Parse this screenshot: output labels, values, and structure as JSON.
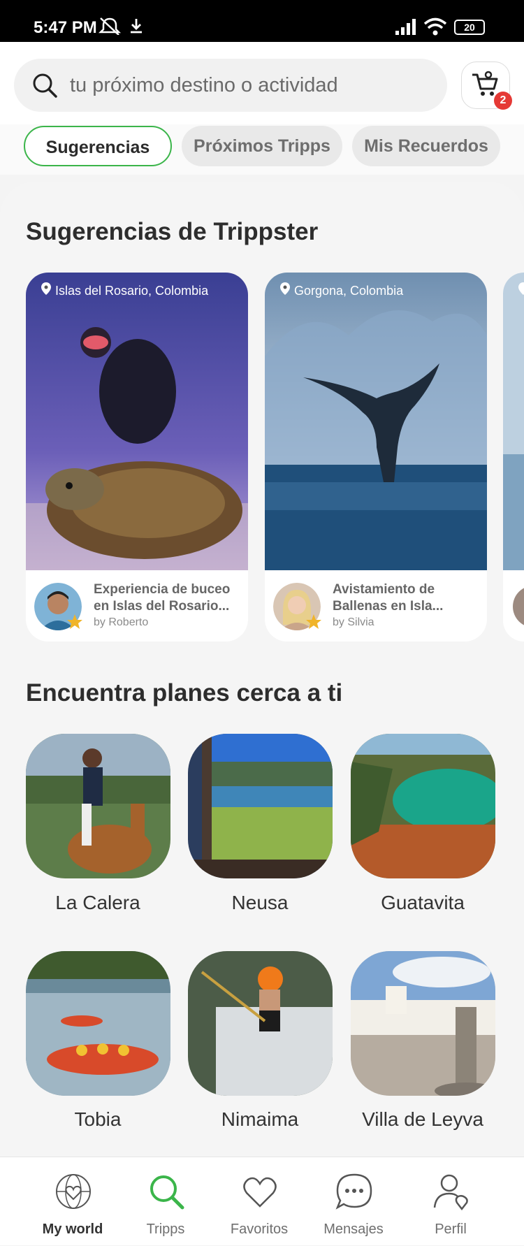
{
  "status_bar": {
    "time": "5:47 PM",
    "battery": "20"
  },
  "search": {
    "placeholder": "tu próximo destino o actividad"
  },
  "cart": {
    "count": "2"
  },
  "tabs": [
    {
      "label": "Sugerencias",
      "active": true
    },
    {
      "label": "Próximos Tripps",
      "active": false
    },
    {
      "label": "Mis Recuerdos",
      "active": false
    }
  ],
  "suggestions": {
    "title": "Sugerencias de Trippster",
    "cards": [
      {
        "location": "Islas del Rosario, Colombia",
        "title": "Experiencia de buceo en Islas del Rosario...",
        "by": "by Roberto"
      },
      {
        "location": "Gorgona, Colombia",
        "title": "Avistamiento de Ballenas en Isla...",
        "by": "by Silvia"
      }
    ]
  },
  "nearby": {
    "title": "Encuentra planes cerca a ti",
    "places": [
      "La Calera",
      "Neusa",
      "Guatavita",
      "Tobia",
      "Nimaima",
      "Villa de Leyva"
    ]
  },
  "bottom_nav": [
    {
      "label": "My world",
      "active": true
    },
    {
      "label": "Tripps",
      "active": false
    },
    {
      "label": "Favoritos",
      "active": false
    },
    {
      "label": "Mensajes",
      "active": false
    },
    {
      "label": "Perfil",
      "active": false
    }
  ],
  "colors": {
    "accent": "#3bb54a",
    "badge": "#e53935"
  }
}
